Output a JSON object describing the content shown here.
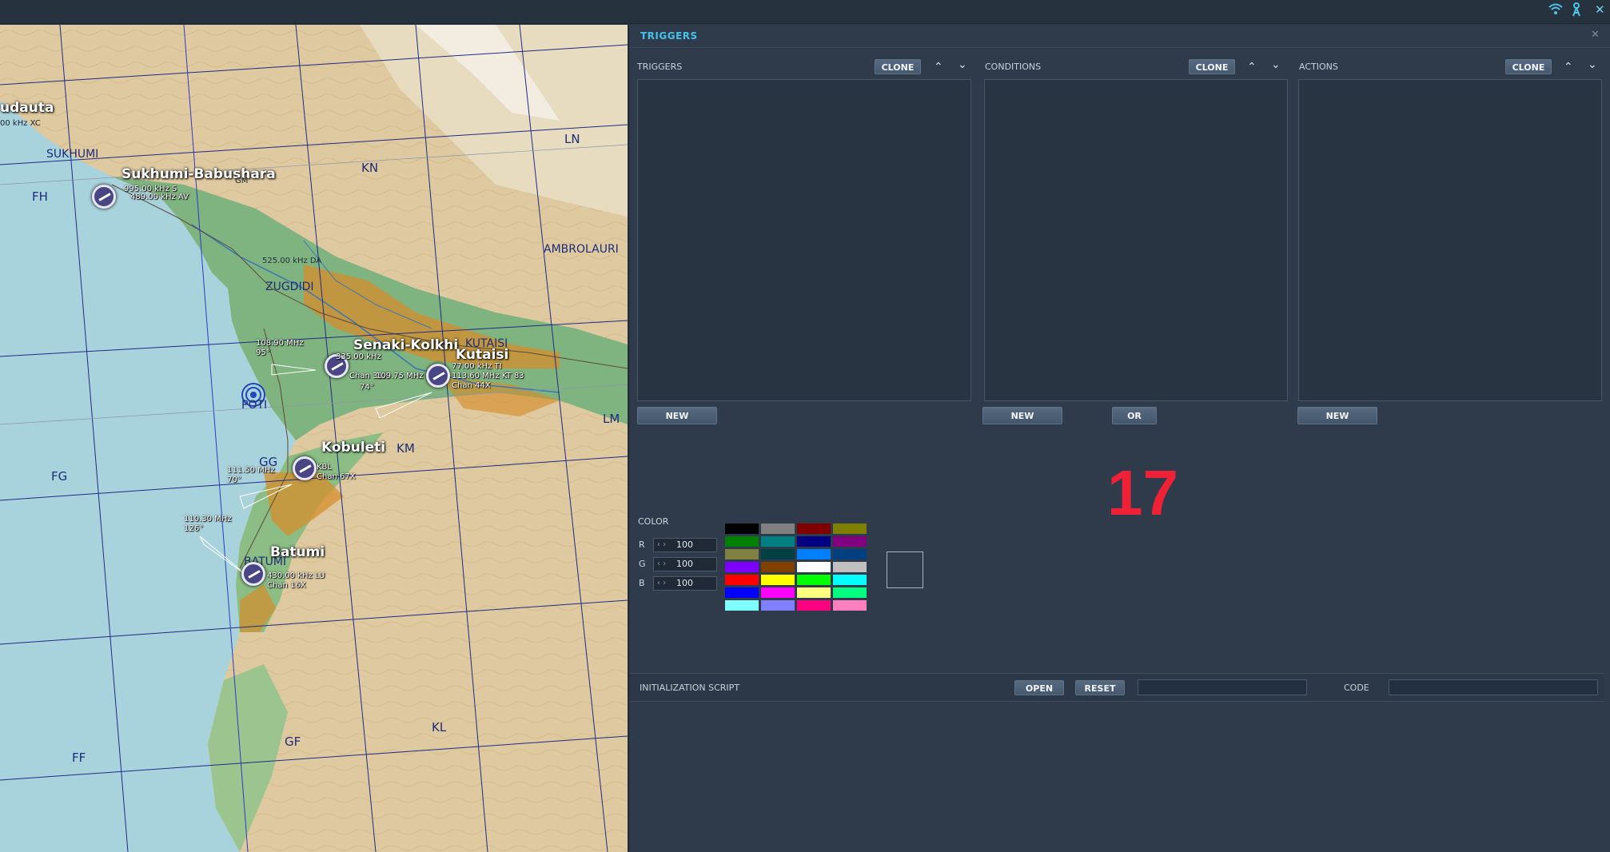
{
  "topbar": {
    "icons": [
      "wifi-icon",
      "antenna-icon",
      "close-icon"
    ],
    "close_glyph": "✕"
  },
  "map": {
    "grid_labels": [
      "FH",
      "FG",
      "FF",
      "GG",
      "GF",
      "KN",
      "KM",
      "KL",
      "LN",
      "LM"
    ],
    "cities": [
      "SUKHUMI",
      "ZUGDIDI",
      "KUTAISI",
      "AMBROLAURI",
      "POTI",
      "BATUMI",
      "udauta"
    ],
    "airfields": [
      "Sukhumi-Babushara",
      "Senaki-Kolkhi",
      "Kutaisi",
      "Kobuleti",
      "Batumi"
    ],
    "nav_text": {
      "gudauta_freq": "00 kHz XC",
      "sukhumi_freq1": "995.00 kHz S",
      "sukhumi_freq2": "489.00 kHz AV",
      "sukhumi_tag": "GM",
      "zugdidi_ndb": "525.00 kHz DA",
      "senaki_ils": "108.90 MHz",
      "senaki_hdg": "95°",
      "senaki_freq1": "335.00 kHz",
      "senaki_freq2": "Chan 31X",
      "kutaisi_vor": "113.60 MHz KT 83",
      "kutaisi_freq1": "77.00 kHz TI",
      "kutaisi_chan": "Chan 44X",
      "kutaisi_hdg": "74°",
      "kutaisi_ils": "109.75 MHz",
      "kobuleti_ils": "111.50 MHz",
      "kobuleti_hdg": "70°",
      "kobuleti_freq": "KBL",
      "kobuleti_chan": "Chan 67X",
      "batumi_ils": "110.30 MHz",
      "batumi_hdg": "126°",
      "batumi_freq": "430.00 kHz LU",
      "batumi_chan": "Chan 16X"
    }
  },
  "panel": {
    "title": "TRIGGERS",
    "close_glyph": "✕",
    "triggers": {
      "label": "TRIGGERS",
      "clone": "CLONE",
      "new": "NEW"
    },
    "conditions": {
      "label": "CONDITIONS",
      "clone": "CLONE",
      "new": "NEW",
      "or": "OR"
    },
    "actions": {
      "label": "ACTIONS",
      "clone": "CLONE",
      "new": "NEW"
    },
    "up_glyph": "⌃",
    "down_glyph": "⌄",
    "overlay_number": "17",
    "color": {
      "label": "COLOR",
      "r_label": "R",
      "r_value": "100",
      "g_label": "G",
      "g_value": "100",
      "b_label": "B",
      "b_value": "100",
      "spin_arrows": "‹ ›",
      "palette": [
        "#000000",
        "#808080",
        "#800000",
        "#808000",
        "#008000",
        "#008080",
        "#000080",
        "#800080",
        "#808040",
        "#004040",
        "#0080ff",
        "#004080",
        "#8000ff",
        "#804000",
        "#ffffff",
        "#c0c0c0",
        "#ff0000",
        "#ffff00",
        "#00ff00",
        "#00ffff",
        "#0000ff",
        "#ff00ff",
        "#ffff80",
        "#00ff80",
        "#80ffff",
        "#8080ff",
        "#ff0080",
        "#ff80c0"
      ]
    },
    "init_script": {
      "label": "INITIALIZATION SCRIPT",
      "open": "OPEN",
      "reset": "RESET",
      "code_label": "CODE"
    }
  }
}
